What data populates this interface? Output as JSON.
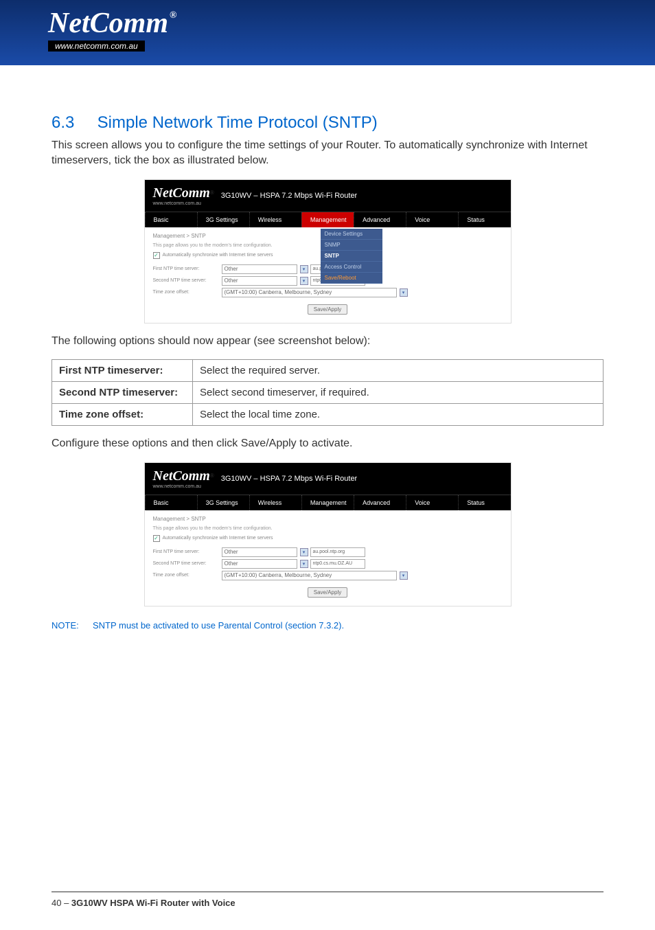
{
  "header": {
    "logo": "NetComm",
    "url": "www.netcomm.com.au"
  },
  "section": {
    "number": "6.3",
    "title": "Simple Network Time Protocol (SNTP)"
  },
  "intro": "This screen allows you to configure the time settings of your Router. To automatically synchronize with Internet timeservers, tick the box as illustrated below.",
  "screenshot1": {
    "logo": "NetComm",
    "logo_url": "www.netcomm.com.au",
    "model": "3G10WV – HSPA 7.2 Mbps Wi-Fi Router",
    "nav": [
      "Basic",
      "3G Settings",
      "Wireless",
      "Management",
      "Advanced",
      "Voice",
      "Status"
    ],
    "nav_active": "Management",
    "dropdown": [
      "Device Settings",
      "SNMP",
      "SNTP",
      "Access Control",
      "Save/Reboot"
    ],
    "dropdown_active": "SNTP",
    "breadcrumb": "Management > SNTP",
    "desc": "This page allows you to the modem's time configuration.",
    "checkbox_label": "Automatically synchronize with Internet time servers",
    "checkbox_checked": true,
    "first_ntp_label": "First NTP time server:",
    "first_ntp_value": "Other",
    "first_ntp_custom": "au.pool.ntp.org",
    "second_ntp_label": "Second NTP time server:",
    "second_ntp_value": "Other",
    "second_ntp_custom": "ntp0.cs.mu.OZ.AU",
    "tz_label": "Time zone offset:",
    "tz_value": "(GMT+10:00) Canberra, Melbourne, Sydney",
    "button": "Save/Apply"
  },
  "mid_text": "The following options should now appear (see screenshot below):",
  "table": {
    "rows": [
      {
        "label": "First NTP timeserver:",
        "value": "Select the required server."
      },
      {
        "label": "Second NTP timeserver:",
        "value": "Select second timeserver, if required."
      },
      {
        "label": "Time zone offset:",
        "value": "Select the local time zone."
      }
    ]
  },
  "configure_text": "Configure these options and then click Save/Apply to activate.",
  "screenshot2": {
    "logo": "NetComm",
    "logo_url": "www.netcomm.com.au",
    "model": "3G10WV – HSPA 7.2 Mbps Wi-Fi Router",
    "nav": [
      "Basic",
      "3G Settings",
      "Wireless",
      "Management",
      "Advanced",
      "Voice",
      "Status"
    ],
    "breadcrumb": "Management > SNTP",
    "desc": "This page allows you to the modem's time configuration.",
    "checkbox_label": "Automatically synchronize with Internet time servers",
    "checkbox_checked": true,
    "first_ntp_label": "First NTP time server:",
    "first_ntp_value": "Other",
    "first_ntp_custom": "au.pool.ntp.org",
    "second_ntp_label": "Second NTP time server:",
    "second_ntp_value": "Other",
    "second_ntp_custom": "ntp0.cs.mu.OZ.AU",
    "tz_label": "Time zone offset:",
    "tz_value": "(GMT+10:00) Canberra, Melbourne, Sydney",
    "button": "Save/Apply"
  },
  "note": {
    "label": "NOTE:",
    "text": "SNTP must be activated to use Parental Control (section 7.3.2)."
  },
  "footer": {
    "page": "40 – ",
    "product": "3G10WV HSPA Wi-Fi Router with Voice"
  }
}
